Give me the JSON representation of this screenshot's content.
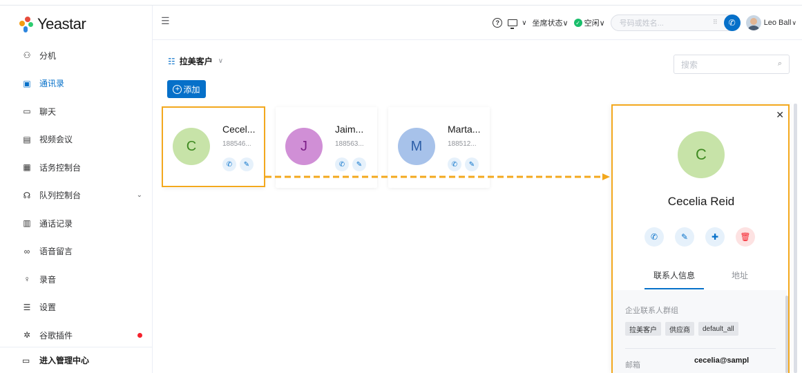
{
  "app": {
    "logo_text": "Yeastar"
  },
  "sidebar": {
    "items": [
      {
        "label": "分机",
        "icon": "extension-icon",
        "glyph": "⚇"
      },
      {
        "label": "通讯录",
        "icon": "contacts-icon",
        "glyph": "▣"
      },
      {
        "label": "聊天",
        "icon": "chat-icon",
        "glyph": "▭"
      },
      {
        "label": "视频会议",
        "icon": "video-conference-icon",
        "glyph": "▤"
      },
      {
        "label": "话务控制台",
        "icon": "operator-console-icon",
        "glyph": "▦"
      },
      {
        "label": "队列控制台",
        "icon": "queue-console-icon",
        "glyph": "☊"
      },
      {
        "label": "通话记录",
        "icon": "call-log-icon",
        "glyph": "▥"
      },
      {
        "label": "语音留言",
        "icon": "voicemail-icon",
        "glyph": "∞"
      },
      {
        "label": "录音",
        "icon": "recording-icon",
        "glyph": "♀"
      },
      {
        "label": "设置",
        "icon": "settings-icon",
        "glyph": "☰"
      },
      {
        "label": "谷歌插件",
        "icon": "plugin-icon",
        "glyph": "✲"
      }
    ],
    "footer_label": "进入管理中心"
  },
  "header": {
    "help_glyph": "?",
    "agent_status_label": "坐席状态∨",
    "presence_label": "空闲∨",
    "dial_placeholder": "号码或姓名...",
    "grid_glyph": "⠿",
    "user_name": "Leo Ball",
    "chevron_glyph": "∨"
  },
  "contacts": {
    "group_label": "拉美客户",
    "add_label": "添加",
    "search_placeholder": "搜索",
    "cards": [
      {
        "initial": "C",
        "name": "Cecel...",
        "number": "188546...",
        "bg": "#c7e3a8",
        "fg": "#3f8a22"
      },
      {
        "initial": "J",
        "name": "Jaim...",
        "number": "188563...",
        "bg": "#d08fd6",
        "fg": "#7b1f87"
      },
      {
        "initial": "M",
        "name": "Marta...",
        "number": "188512...",
        "bg": "#a7c2ea",
        "fg": "#2d5fa8"
      }
    ]
  },
  "detail": {
    "initial": "C",
    "name": "Cecelia Reid",
    "tab_info": "联系人信息",
    "tab_address": "地址",
    "group_section_title": "企业联系人群组",
    "groups": [
      "拉美客户",
      "供应商",
      "default_all"
    ],
    "email_label": "邮箱",
    "email_value": "cecelia@sampl"
  },
  "colors": {
    "accent": "#0670c9",
    "highlight": "#f3a81d",
    "delete": "#f5222d"
  }
}
